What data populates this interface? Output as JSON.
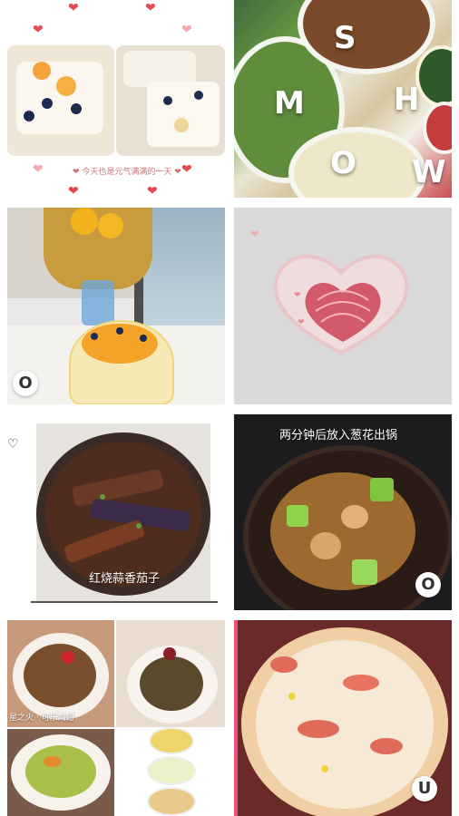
{
  "collage": {
    "top_left": {
      "small_caption": "❤ 今天也是元气满满的一天 ❤"
    },
    "top_right": {
      "letters": [
        "S",
        "H",
        "M",
        "O",
        "W"
      ]
    },
    "middle_left": {
      "badge": "O"
    },
    "middle_right": {},
    "lower_left": {
      "caption": "红烧蒜香茄子"
    },
    "lower_right": {
      "caption": "两分钟后放入葱花出锅",
      "badge": "O"
    },
    "bottom_left": {
      "caption": "星之火 · 可乐鸡翅"
    },
    "bottom_right": {
      "badge": "U"
    }
  },
  "colors": {
    "heart_red": "#e5484d",
    "heart_pale": "#f7a7b0",
    "frame_gray": "#d9d9d9"
  }
}
